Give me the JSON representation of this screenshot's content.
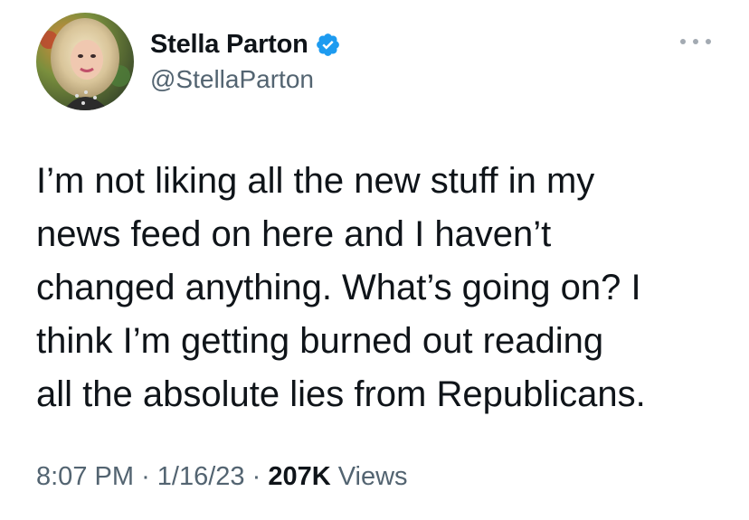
{
  "author": {
    "display_name": "Stella Parton",
    "handle": "@StellaParton",
    "verified": true,
    "verified_color": "#1d9bf0"
  },
  "tweet": {
    "lines": [
      "I’m not liking all the new stuff in my",
      "news feed on here and I haven’t",
      "changed anything. What’s going on? I",
      "think I’m getting burned out reading",
      "all the absolute lies from Republicans."
    ]
  },
  "meta": {
    "time": "8:07 PM",
    "separator": "·",
    "date": "1/16/23",
    "views_count": "207K",
    "views_label": "Views"
  },
  "icons": {
    "verified": "verified-badge-icon",
    "more": "more-options-icon"
  }
}
